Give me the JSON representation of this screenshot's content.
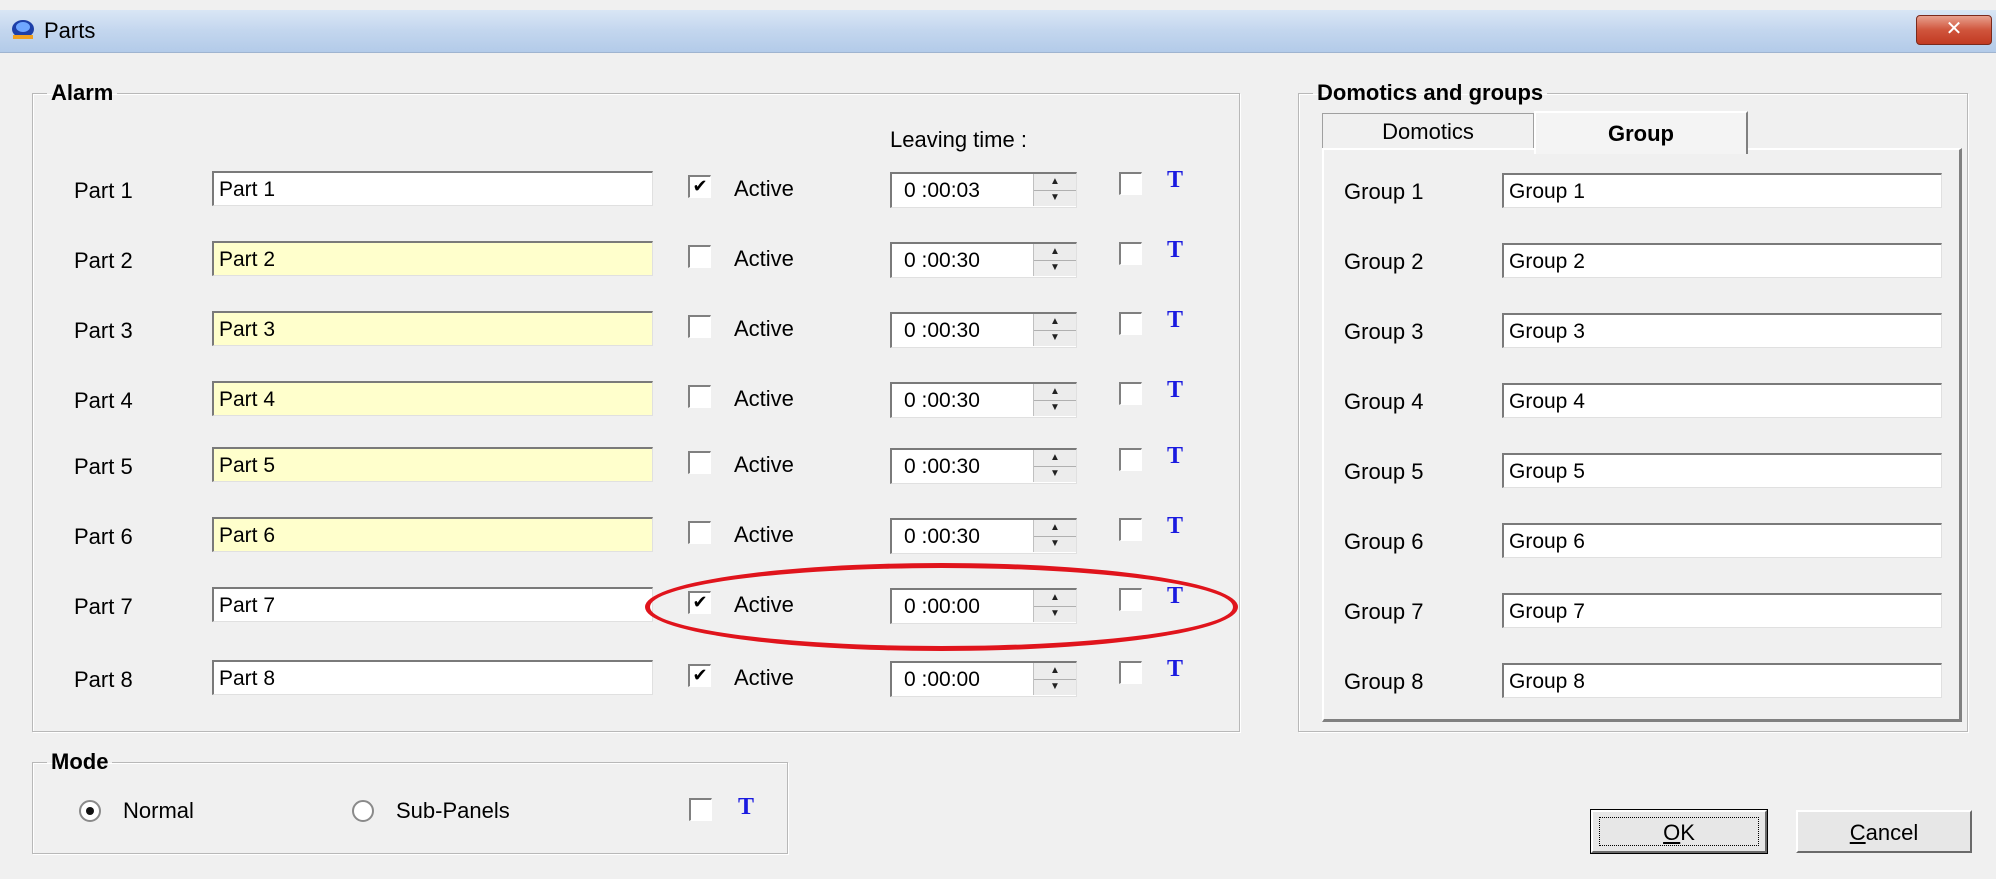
{
  "window": {
    "title": "Parts",
    "close_glyph": "✕"
  },
  "alarm": {
    "legend": "Alarm",
    "leaving_time_label": "Leaving time :",
    "rows": [
      {
        "label": "Part 1",
        "value": "Part 1",
        "active": true,
        "active_label": "Active",
        "time": "0 :00:03",
        "t_checked": false,
        "t_label": "T"
      },
      {
        "label": "Part 2",
        "value": "Part 2",
        "active": false,
        "active_label": "Active",
        "time": "0 :00:30",
        "t_checked": false,
        "t_label": "T"
      },
      {
        "label": "Part 3",
        "value": "Part 3",
        "active": false,
        "active_label": "Active",
        "time": "0 :00:30",
        "t_checked": false,
        "t_label": "T"
      },
      {
        "label": "Part 4",
        "value": "Part 4",
        "active": false,
        "active_label": "Active",
        "time": "0 :00:30",
        "t_checked": false,
        "t_label": "T"
      },
      {
        "label": "Part 5",
        "value": "Part 5",
        "active": false,
        "active_label": "Active",
        "time": "0 :00:30",
        "t_checked": false,
        "t_label": "T"
      },
      {
        "label": "Part 6",
        "value": "Part 6",
        "active": false,
        "active_label": "Active",
        "time": "0 :00:30",
        "t_checked": false,
        "t_label": "T"
      },
      {
        "label": "Part 7",
        "value": "Part 7",
        "active": true,
        "active_label": "Active",
        "time": "0 :00:00",
        "t_checked": false,
        "t_label": "T"
      },
      {
        "label": "Part 8",
        "value": "Part 8",
        "active": true,
        "active_label": "Active",
        "time": "0 :00:00",
        "t_checked": false,
        "t_label": "T"
      }
    ]
  },
  "domotics": {
    "legend": "Domotics and groups",
    "tabs": [
      {
        "label": "Domotics",
        "active": false
      },
      {
        "label": "Group",
        "active": true
      }
    ],
    "rows": [
      {
        "label": "Group 1",
        "value": "Group 1"
      },
      {
        "label": "Group 2",
        "value": "Group 2"
      },
      {
        "label": "Group 3",
        "value": "Group 3"
      },
      {
        "label": "Group 4",
        "value": "Group 4"
      },
      {
        "label": "Group 5",
        "value": "Group 5"
      },
      {
        "label": "Group 6",
        "value": "Group 6"
      },
      {
        "label": "Group 7",
        "value": "Group 7"
      },
      {
        "label": "Group 8",
        "value": "Group 8"
      }
    ]
  },
  "mode": {
    "legend": "Mode",
    "options": [
      {
        "label": "Normal",
        "selected": true
      },
      {
        "label": "Sub-Panels",
        "selected": false
      }
    ],
    "t_checked": false,
    "t_label": "T"
  },
  "buttons": {
    "ok_label": "OK",
    "ok_mnemonic": "O",
    "ok_rest": "K",
    "cancel_label": "Cancel",
    "cancel_mnemonic": "C",
    "cancel_rest": "ancel"
  },
  "colors": {
    "highlight_yellow": "#ffffcc",
    "annotation_red": "#e0141c",
    "t_blue": "#1a1ae0"
  },
  "icons": {
    "app": "app-logo-icon",
    "close": "close-icon",
    "check": "checkmark-icon",
    "spin_up": "spin-up-icon",
    "spin_down": "spin-down-icon"
  }
}
